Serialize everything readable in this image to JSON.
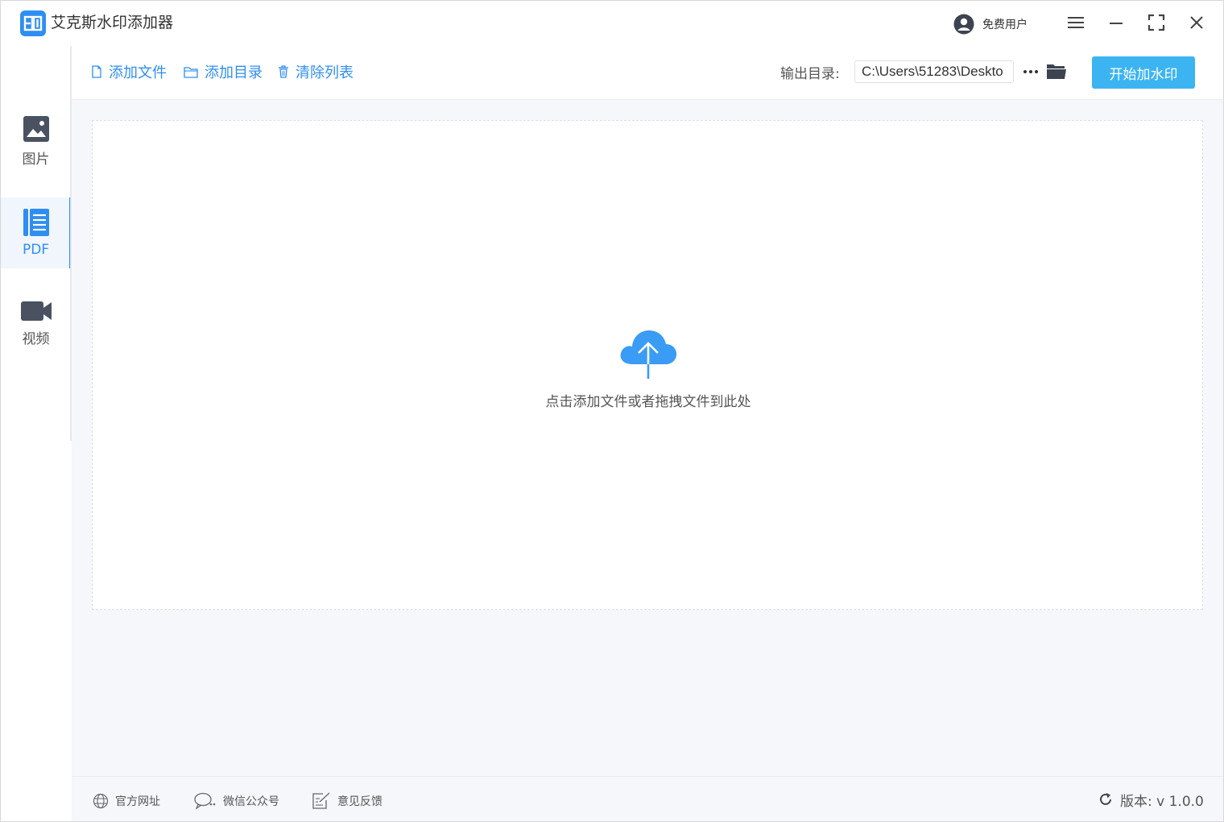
{
  "app": {
    "title": "艾克斯水印添加器",
    "user_label": "免费用户"
  },
  "sidebar": {
    "items": [
      {
        "label": "图片",
        "icon": "image-icon",
        "active": false
      },
      {
        "label": "PDF",
        "icon": "document-icon",
        "active": true
      },
      {
        "label": "视频",
        "icon": "video-camera-icon",
        "active": false
      }
    ]
  },
  "toolbar": {
    "add_file": "添加文件",
    "add_folder": "添加目录",
    "clear_list": "清除列表",
    "output_label": "输出目录:",
    "output_path": "C:\\Users\\51283\\Deskto",
    "start_button": "开始加水印"
  },
  "dropzone": {
    "text": "点击添加文件或者拖拽文件到此处"
  },
  "footer": {
    "website": "官方网址",
    "wechat": "微信公众号",
    "feedback": "意见反馈",
    "version": "版本: v 1.0.0"
  },
  "colors": {
    "accent": "#2f8ef1",
    "start_button": "#3db4f2",
    "background": "#f5f7fa"
  }
}
